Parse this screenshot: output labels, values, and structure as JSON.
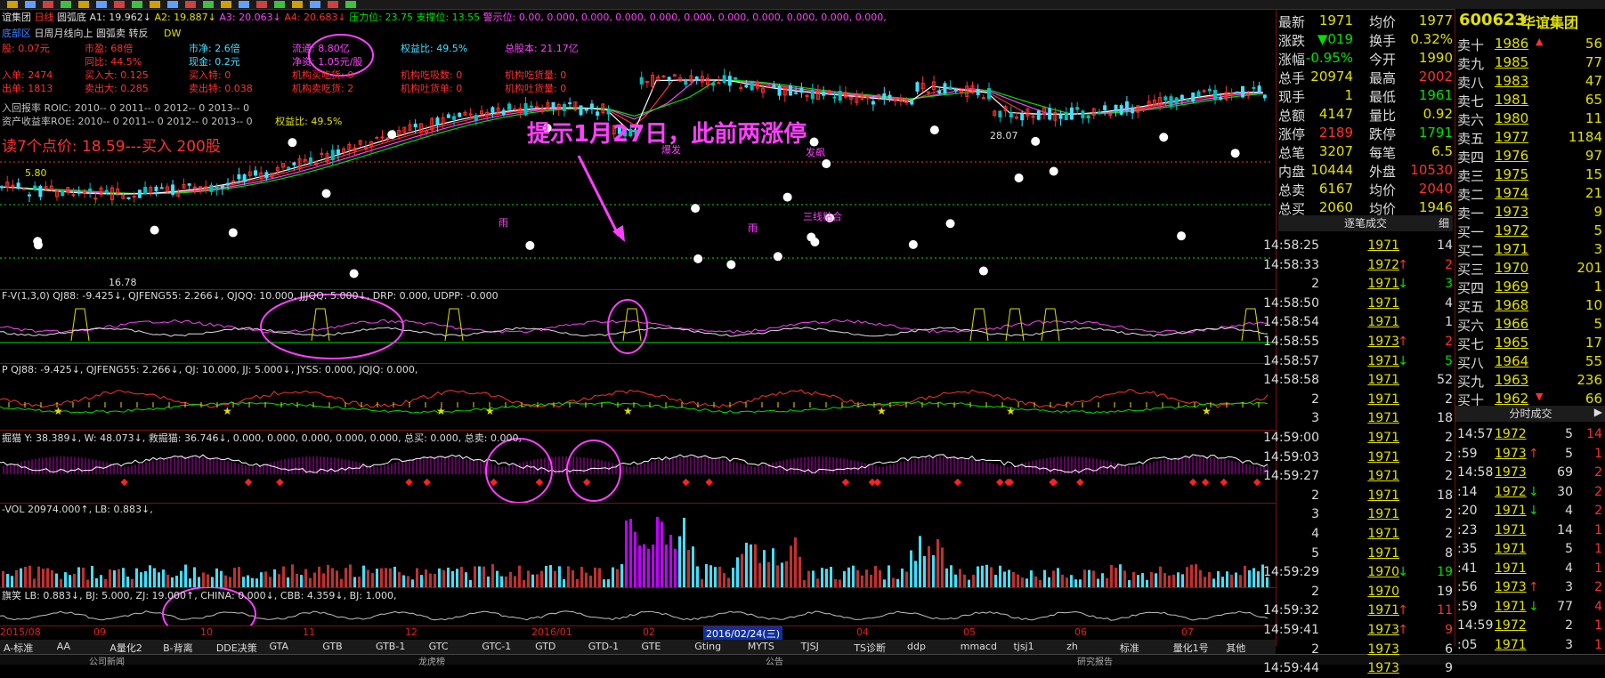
{
  "main_header": {
    "stock": "谊集团",
    "period": "日线",
    "indicator": "圆弧底",
    "a1": "A1: 19.962↓",
    "a2": "A2: 19.887↓",
    "a3": "A3: 20.063↓",
    "a4": "A4: 20.683↓",
    "pressure": "压力位: 23.75",
    "support": "支撑位: 13.55",
    "alert": "警示位: 0.00, 0.000, 0.000, 0.000, 0.000, 0.000, 0.000, 0.000, 0.000, 0.000, 0.000,"
  },
  "main_line2": {
    "a": "底部区",
    "b": "日周月线向上",
    "c": "圆弧卖",
    "d": "转反",
    "e": "DW"
  },
  "fundamentals": {
    "r1": [
      "股: 0.07元",
      "市盈: 68倍",
      "市净: 2.6倍",
      "流通: 8.80亿",
      "权益比: 49.5%",
      "总股本: 21.17亿"
    ],
    "r2": [
      "",
      "同比: 44.5%",
      "现金: 0.2元",
      "净资: 1.05元/股"
    ],
    "r3": [
      "入单: 2474",
      "买入大: 0.125",
      "买入特: 0",
      "机构买吃货: 0",
      "机构吃吸数: 0",
      "机构吃货量: 0"
    ],
    "r4": [
      "出单: 1813",
      "卖出大: 0.285",
      "卖出特: 0.038",
      "机构卖吃货: 2",
      "机构吐货单: 0",
      "机构吐货量: 0"
    ],
    "roic": "入回报率 ROIC: 2010-- 0     2011-- 0     2012-- 0     2013-- 0",
    "roe": "资产收益率ROE: 2010-- 0     2011-- 0     2012-- 0     2013-- 0",
    "roe_ratio": "权益比: 49.5%",
    "buy_point": "读7个点价: 18.59---买入 200股"
  },
  "annotation": "提示1月27日，此前两涨停",
  "price_labels": {
    "high": "28.07",
    "low": "16.78",
    "left": "5.80",
    "tags": [
      "爆发",
      "发飙",
      "三线粘合",
      "雨",
      "雨"
    ]
  },
  "panel_headers": {
    "p2": "F-V(1,3,0) QJ88: -9.425↓, QJFENG55: 2.266↓, QJQQ: 10.000, JJJQQ: 5.000↓, DRP: 0.000, UDPP: -0.000",
    "p3": "P QJ88: -9.425↓, QJFENG55: 2.266↓, QJ: 10.000, JJ: 5.000↓, JYSS: 0.000, JQJQ: 0.000,",
    "p4": "掘猫 Y: 38.389↓, W: 48.073↓, 救掘猫: 36.746↓, 0.000, 0.000, 0.000, 0.000, 0.000, 总买: 0.000, 总卖: 0.000,",
    "p5": "-VOL 20974.000↑, LB: 0.883↓,",
    "p6": "旗笑 LB: 0.883↓, BJ: 5.000, ZJ: 19.000↑, CHINA: 0.000↓, CBB: 4.359↓, BJ: 1.000,"
  },
  "dates": [
    "2015/08",
    "09",
    "10",
    "11",
    "12",
    "2016/01",
    "02",
    "03",
    "04",
    "05",
    "06",
    "07"
  ],
  "current_date": "2016/02/24(三)",
  "tabs": [
    "A-标准",
    "AA",
    "A量化2",
    "B-背离",
    "DDE决策",
    "GTA",
    "GTB",
    "GTB-1",
    "GTC",
    "GTC-1",
    "GTD",
    "GTD-1",
    "GTE",
    "Gting",
    "MYTS",
    "TJSJ",
    "TS诊断",
    "ddp",
    "mmacd",
    "tjsj1",
    "zh",
    "标准",
    "量化1号",
    "其他"
  ],
  "bottom_tabs": [
    "公司新闻",
    "龙虎榜",
    "公告",
    "研究报告"
  ],
  "quote": [
    {
      "l": "最新",
      "v": "1971",
      "l2": "均价",
      "v2": "1977"
    },
    {
      "l": "涨跌",
      "v": "▼019",
      "l2": "换手",
      "v2": "0.32%"
    },
    {
      "l": "涨幅",
      "v": "-0.95%",
      "l2": "今开",
      "v2": "1990"
    },
    {
      "l": "总手",
      "v": "20974",
      "l2": "最高",
      "v2": "2002"
    },
    {
      "l": "现手",
      "v": "1",
      "l2": "最低",
      "v2": "1961"
    },
    {
      "l": "总额",
      "v": "4147",
      "l2": "量比",
      "v2": "0.92"
    },
    {
      "l": "涨停",
      "v": "2189",
      "l2": "跌停",
      "v2": "1791"
    },
    {
      "l": "总笔",
      "v": "3207",
      "l2": "每笔",
      "v2": "6.5"
    },
    {
      "l": "内盘",
      "v": "10444",
      "l2": "外盘",
      "v2": "10530"
    },
    {
      "l": "总卖",
      "v": "6167",
      "l2": "均价",
      "v2": "2040"
    },
    {
      "l": "总买",
      "v": "2060",
      "l2": "均价",
      "v2": "1946"
    }
  ],
  "tick_header": "逐笔成交",
  "tick_btn": "细",
  "ticks": [
    {
      "t": "14:58:25",
      "p": "1971",
      "a": "",
      "v": "14"
    },
    {
      "t": "14:58:33",
      "p": "1972",
      "a": "↑",
      "v": "2"
    },
    {
      "t": "2",
      "p": "1971",
      "a": "↓",
      "v": "3"
    },
    {
      "t": "14:58:50",
      "p": "1971",
      "a": "",
      "v": "4"
    },
    {
      "t": "14:58:54",
      "p": "1971",
      "a": "",
      "v": "1"
    },
    {
      "t": "14:58:55",
      "p": "1973",
      "a": "↑",
      "v": "2"
    },
    {
      "t": "14:58:57",
      "p": "1971",
      "a": "↓",
      "v": "5"
    },
    {
      "t": "14:58:58",
      "p": "1971",
      "a": "",
      "v": "52"
    },
    {
      "t": "2",
      "p": "1971",
      "a": "",
      "v": "2"
    },
    {
      "t": "3",
      "p": "1971",
      "a": "",
      "v": "18"
    },
    {
      "t": "14:59:00",
      "p": "1971",
      "a": "",
      "v": "2"
    },
    {
      "t": "14:59:03",
      "p": "1971",
      "a": "",
      "v": "2"
    },
    {
      "t": "14:59:27",
      "p": "1971",
      "a": "",
      "v": "2"
    },
    {
      "t": "2",
      "p": "1971",
      "a": "",
      "v": "18"
    },
    {
      "t": "3",
      "p": "1971",
      "a": "",
      "v": "2"
    },
    {
      "t": "4",
      "p": "1971",
      "a": "",
      "v": "2"
    },
    {
      "t": "5",
      "p": "1971",
      "a": "",
      "v": "8"
    },
    {
      "t": "14:59:29",
      "p": "1970",
      "a": "↓",
      "v": "19"
    },
    {
      "t": "2",
      "p": "1970",
      "a": "",
      "v": "19"
    },
    {
      "t": "14:59:32",
      "p": "1971",
      "a": "↑",
      "v": "11"
    },
    {
      "t": "14:59:41",
      "p": "1973",
      "a": "↑",
      "v": "9"
    },
    {
      "t": "2",
      "p": "1973",
      "a": "",
      "v": "6"
    },
    {
      "t": "14:59:44",
      "p": "1973",
      "a": "",
      "v": "9"
    }
  ],
  "ob_title": {
    "code": "600623",
    "name": "华谊集团"
  },
  "sells": [
    {
      "l": "卖十",
      "p": "1986",
      "a": "▲",
      "v": "56"
    },
    {
      "l": "卖九",
      "p": "1985",
      "a": "",
      "v": "77"
    },
    {
      "l": "卖八",
      "p": "1983",
      "a": "",
      "v": "47"
    },
    {
      "l": "卖七",
      "p": "1981",
      "a": "",
      "v": "65"
    },
    {
      "l": "卖六",
      "p": "1980",
      "a": "",
      "v": "11"
    },
    {
      "l": "卖五",
      "p": "1977",
      "a": "",
      "v": "1184"
    },
    {
      "l": "卖四",
      "p": "1976",
      "a": "",
      "v": "97"
    },
    {
      "l": "卖三",
      "p": "1975",
      "a": "",
      "v": "15"
    },
    {
      "l": "卖二",
      "p": "1974",
      "a": "",
      "v": "21"
    },
    {
      "l": "卖一",
      "p": "1973",
      "a": "",
      "v": "9"
    }
  ],
  "buys": [
    {
      "l": "买一",
      "p": "1972",
      "a": "",
      "v": "5"
    },
    {
      "l": "买二",
      "p": "1971",
      "a": "",
      "v": "3"
    },
    {
      "l": "买三",
      "p": "1970",
      "a": "",
      "v": "201"
    },
    {
      "l": "买四",
      "p": "1969",
      "a": "",
      "v": "1"
    },
    {
      "l": "买五",
      "p": "1968",
      "a": "",
      "v": "10"
    },
    {
      "l": "买六",
      "p": "1966",
      "a": "",
      "v": "5"
    },
    {
      "l": "买七",
      "p": "1965",
      "a": "",
      "v": "17"
    },
    {
      "l": "买八",
      "p": "1964",
      "a": "",
      "v": "55"
    },
    {
      "l": "买九",
      "p": "1963",
      "a": "",
      "v": "236"
    },
    {
      "l": "买十",
      "p": "1962",
      "a": "▼",
      "v": "66"
    }
  ],
  "minute_header": "分时成交",
  "minutes": [
    {
      "t": "14:57",
      "p": "1972",
      "a": "",
      "v": "5",
      "v2": "14"
    },
    {
      "t": ":59",
      "p": "1973",
      "a": "↑",
      "v": "5",
      "v2": "1"
    },
    {
      "t": "14:58",
      "p": "1973",
      "a": "",
      "v": "69",
      "v2": "2"
    },
    {
      "t": ":14",
      "p": "1972",
      "a": "↓",
      "v": "30",
      "v2": "2"
    },
    {
      "t": ":20",
      "p": "1971",
      "a": "↓",
      "v": "4",
      "v2": "2"
    },
    {
      "t": ":23",
      "p": "1971",
      "a": "",
      "v": "14",
      "v2": "1"
    },
    {
      "t": ":35",
      "p": "1971",
      "a": "",
      "v": "5",
      "v2": "1"
    },
    {
      "t": ":41",
      "p": "1971",
      "a": "",
      "v": "4",
      "v2": "1"
    },
    {
      "t": ":56",
      "p": "1973",
      "a": "↑",
      "v": "3",
      "v2": "2"
    },
    {
      "t": ":59",
      "p": "1971",
      "a": "↓",
      "v": "77",
      "v2": "4"
    },
    {
      "t": "14:59",
      "p": "1972",
      "a": "",
      "v": "2",
      "v2": "1"
    },
    {
      "t": ":05",
      "p": "1971",
      "a": "",
      "v": "3",
      "v2": "1"
    }
  ],
  "colors": {
    "up": "#ff3030",
    "down": "#00e000",
    "price": "#e0e000",
    "border": "#7a1010",
    "annot": "#ff40ff",
    "cyan": "#40e0ff"
  },
  "icons": [
    "toolbar-icons",
    "right-arrow-icon"
  ]
}
